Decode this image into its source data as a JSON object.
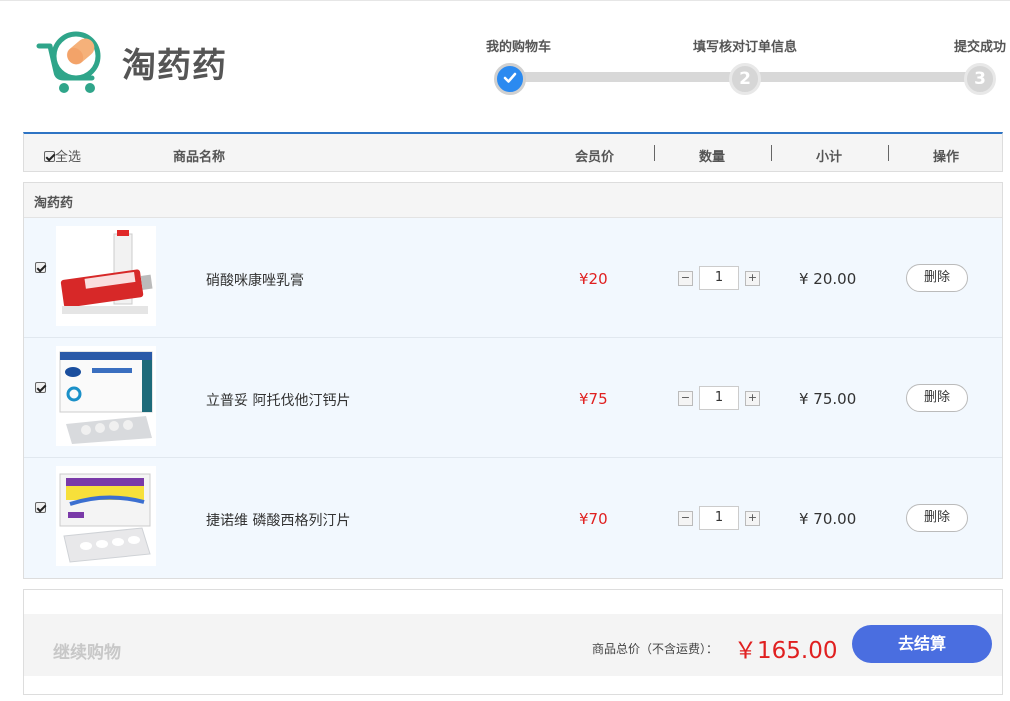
{
  "brand": {
    "name": "淘药药",
    "accent": "#2e74c4",
    "logo_green": "#2fa58a",
    "logo_orange": "#f5b17a"
  },
  "steps": [
    {
      "label": "我的购物车",
      "number": "",
      "state": "done"
    },
    {
      "label": "填写核对订单信息",
      "number": "2",
      "state": "pending"
    },
    {
      "label": "提交成功",
      "number": "3",
      "state": "pending"
    }
  ],
  "table_header": {
    "select_all": "全选",
    "name": "商品名称",
    "member_price": "会员价",
    "quantity": "数量",
    "subtotal": "小计",
    "action": "操作"
  },
  "store": {
    "name": "淘药药",
    "items": [
      {
        "name": "硝酸咪康唑乳膏",
        "price": "¥20",
        "qty": "1",
        "subtotal": "¥ 20.00",
        "delete": "删除",
        "checked": true
      },
      {
        "name": "立普妥  阿托伐他汀钙片",
        "price": "¥75",
        "qty": "1",
        "subtotal": "¥ 75.00",
        "delete": "删除",
        "checked": true
      },
      {
        "name": "捷诺维  磷酸西格列汀片",
        "price": "¥70",
        "qty": "1",
        "subtotal": "¥ 70.00",
        "delete": "删除",
        "checked": true
      }
    ]
  },
  "qty_controls": {
    "minus": "−",
    "plus": "+"
  },
  "footer": {
    "continue": "继续购物",
    "total_label": "商品总价（不含运费）：",
    "total": "￥165.00",
    "checkout": "去结算"
  }
}
